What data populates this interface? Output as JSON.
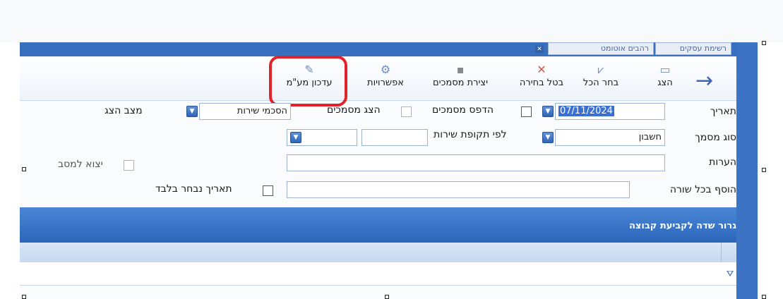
{
  "window": {
    "tab_title": "רשימת עסקים",
    "tab_title_2": "רהבים אוטומט"
  },
  "toolbar": {
    "buttons": [
      {
        "label": "הצג",
        "icon": "display-icon"
      },
      {
        "label": "בחר הכל",
        "icon": "select-all-icon"
      },
      {
        "label": "בטל בחירה",
        "icon": "cancel-icon"
      },
      {
        "label": "יצירת מסמכים",
        "icon": "create-docs-icon"
      },
      {
        "label": "אפשרויות",
        "icon": "gear-icon"
      },
      {
        "label": "עדכון מע\"מ",
        "icon": "pencil-icon"
      }
    ],
    "back_icon": "arrow-right-icon"
  },
  "form": {
    "date_label": "תאריך",
    "date_value": "07/11/2024",
    "print_docs_label": "הדפס מסמכים",
    "show_docs_label": "הצג מסמכים",
    "service_agreements_value": "הסכמי שירות",
    "display_mode_label": "מצב הצג",
    "doc_type_label": "סוג מסמך",
    "doc_type_value": "חשבון",
    "by_service_period_label": "לפי תקופת שירות",
    "service_period_value": "",
    "notes_label": "הערות",
    "notes_value": "",
    "export_label": "יצוא למסב",
    "add_each_line_label": "הוסף בכל שורה",
    "add_each_line_value": "",
    "selected_date_only_label": "תאריך נבחר בלבד"
  },
  "grid": {
    "group_hint": "גרור שדה לקביעת קבוצה",
    "filter_icon": "filter-icon"
  }
}
